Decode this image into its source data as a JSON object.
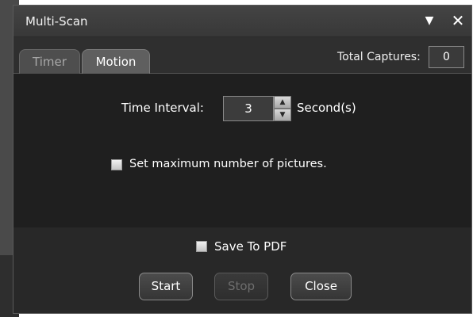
{
  "window": {
    "title": "Multi-Scan",
    "dropdown_icon": "▼",
    "close_icon": "✕"
  },
  "tabs": [
    {
      "label": "Timer",
      "active": false
    },
    {
      "label": "Motion",
      "active": true
    }
  ],
  "captures": {
    "label": "Total Captures:",
    "value": "0"
  },
  "interval": {
    "label": "Time Interval:",
    "value": "3",
    "unit": "Second(s)"
  },
  "max_pictures": {
    "label": "Set maximum number of pictures.",
    "checked": false
  },
  "save_pdf": {
    "label": "Save To PDF",
    "checked": false
  },
  "buttons": {
    "start": "Start",
    "stop": "Stop",
    "close": "Close"
  },
  "colors": {
    "window_bg": "#1f1f1f",
    "titlebar_bg": "#3e3e3e",
    "disabled_text": "#6e6e6e"
  }
}
